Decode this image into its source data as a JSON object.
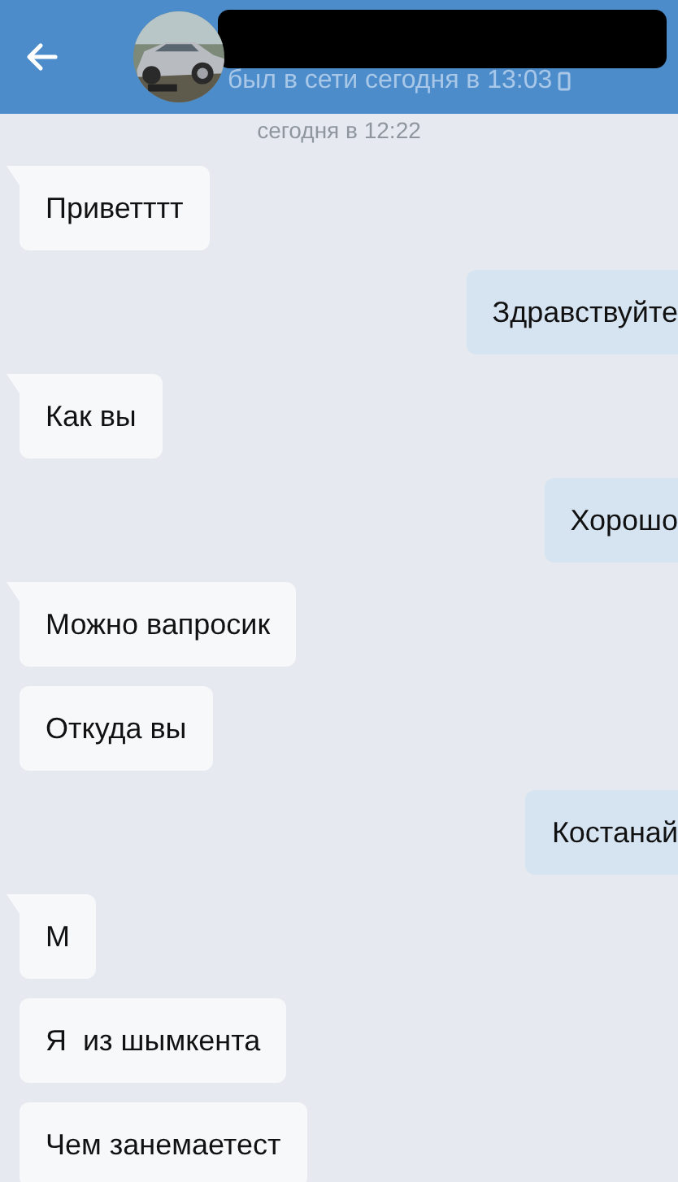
{
  "header": {
    "status": "был в сети сегодня в 13:03"
  },
  "date": "сегодня в 12:22",
  "messages": [
    {
      "kind": "in",
      "text": "Приветттт",
      "tail": true
    },
    {
      "kind": "out",
      "text": "Здравствуйте",
      "tail": false
    },
    {
      "kind": "in",
      "text": "Как вы",
      "tail": true
    },
    {
      "kind": "out",
      "text": "Хорошо",
      "tail": false
    },
    {
      "kind": "in",
      "text": "Можно вапросик",
      "tail": true
    },
    {
      "kind": "in",
      "text": "Откуда вы",
      "tail": false
    },
    {
      "kind": "out",
      "text": "Костанай",
      "tail": false
    },
    {
      "kind": "in",
      "text": "М",
      "tail": true
    },
    {
      "kind": "in",
      "text": "Я  из шымкента",
      "tail": false
    },
    {
      "kind": "in",
      "text": "Чем занемаетест",
      "tail": false
    }
  ]
}
